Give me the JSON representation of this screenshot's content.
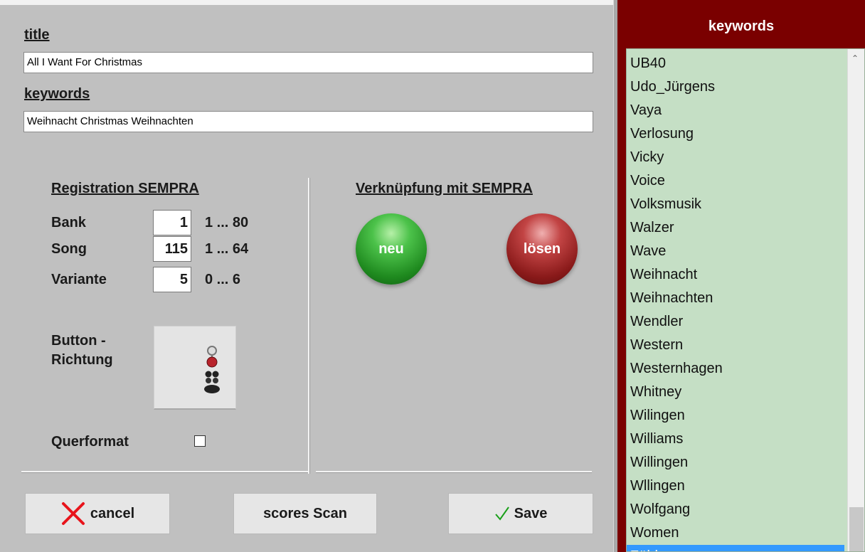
{
  "form": {
    "title_label": "title",
    "title_value": "All I Want For Christmas",
    "keywords_label": "keywords",
    "keywords_value": "Weihnacht Christmas Weihnachten"
  },
  "registration": {
    "heading": "Registration SEMPRA",
    "rows": [
      {
        "label": "Bank",
        "value": "1",
        "range": "1 ... 80"
      },
      {
        "label": "Song",
        "value": "115",
        "range": "1 ... 64"
      },
      {
        "label": "Variante",
        "value": "5",
        "range": "0 ... 6"
      }
    ],
    "button_direction_label_1": "Button -",
    "button_direction_label_2": "Richtung",
    "querformat_label": "Querformat",
    "querformat_checked": false
  },
  "link": {
    "heading": "Verknüpfung mit SEMPRA",
    "new_label": "neu",
    "remove_label": "lösen"
  },
  "buttons": {
    "cancel": "cancel",
    "scan": "scores Scan",
    "save": "Save"
  },
  "keywords_panel": {
    "heading": "keywords",
    "items": [
      "UB40",
      "Udo_Jürgens",
      "Vaya",
      "Verlosung",
      "Vicky",
      "Voice",
      "Volksmusik",
      "Walzer",
      "Wave",
      "Weihnacht",
      "Weihnachten",
      "Wendler",
      "Western",
      "Westernhagen",
      "Whitney",
      "Wilingen",
      "Williams",
      "Willingen",
      "Wllingen",
      "Wolfgang",
      "Women",
      "Zähler"
    ],
    "selected_index": 21
  },
  "colors": {
    "panel_bg": "#c0c0c0",
    "keywords_bg": "#7a0000",
    "list_bg": "#c5dfc5",
    "selection": "#3399ff"
  }
}
